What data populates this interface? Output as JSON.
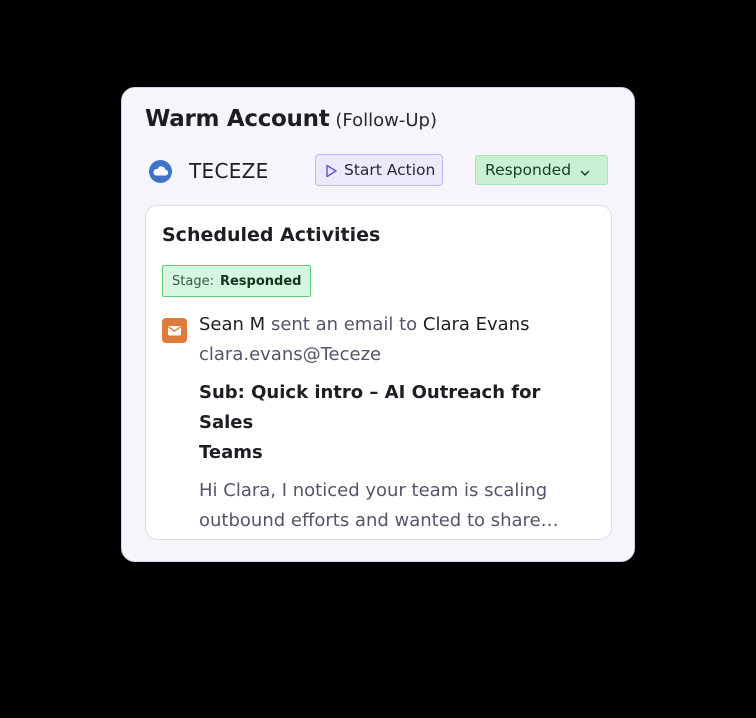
{
  "card": {
    "title": "Warm Account",
    "title_suffix": "(Follow-Up)"
  },
  "account": {
    "icon": "cloud-icon",
    "company": "TECEZE",
    "start_action_label": "Start Action",
    "start_action_icon": "play-icon",
    "status": "Responded",
    "status_icon": "chevron-down-icon"
  },
  "activities": {
    "heading": "Scheduled Activities",
    "stage_label": "Stage:",
    "stage_value": "Responded",
    "item": {
      "icon": "email-icon",
      "sender": "Sean M",
      "verb": "sent an email to",
      "recipient": "Clara Evans",
      "address": "clara.evans@Teceze",
      "subject_line1": "Sub: Quick intro – AI Outreach for Sales",
      "subject_line2": "Teams",
      "preview_line1": "Hi Clara, I noticed your team is scaling",
      "preview_line2": "outbound efforts and wanted to share…"
    }
  },
  "colors": {
    "page_background": "#000000",
    "card_background": "#f6f5fb",
    "accent_purple": "#c3b8f0",
    "status_green": "#c9f0d3",
    "stage_border_green": "#5fcb7d",
    "cloud_blue": "#3d74c7",
    "email_orange": "#e07b3e"
  }
}
